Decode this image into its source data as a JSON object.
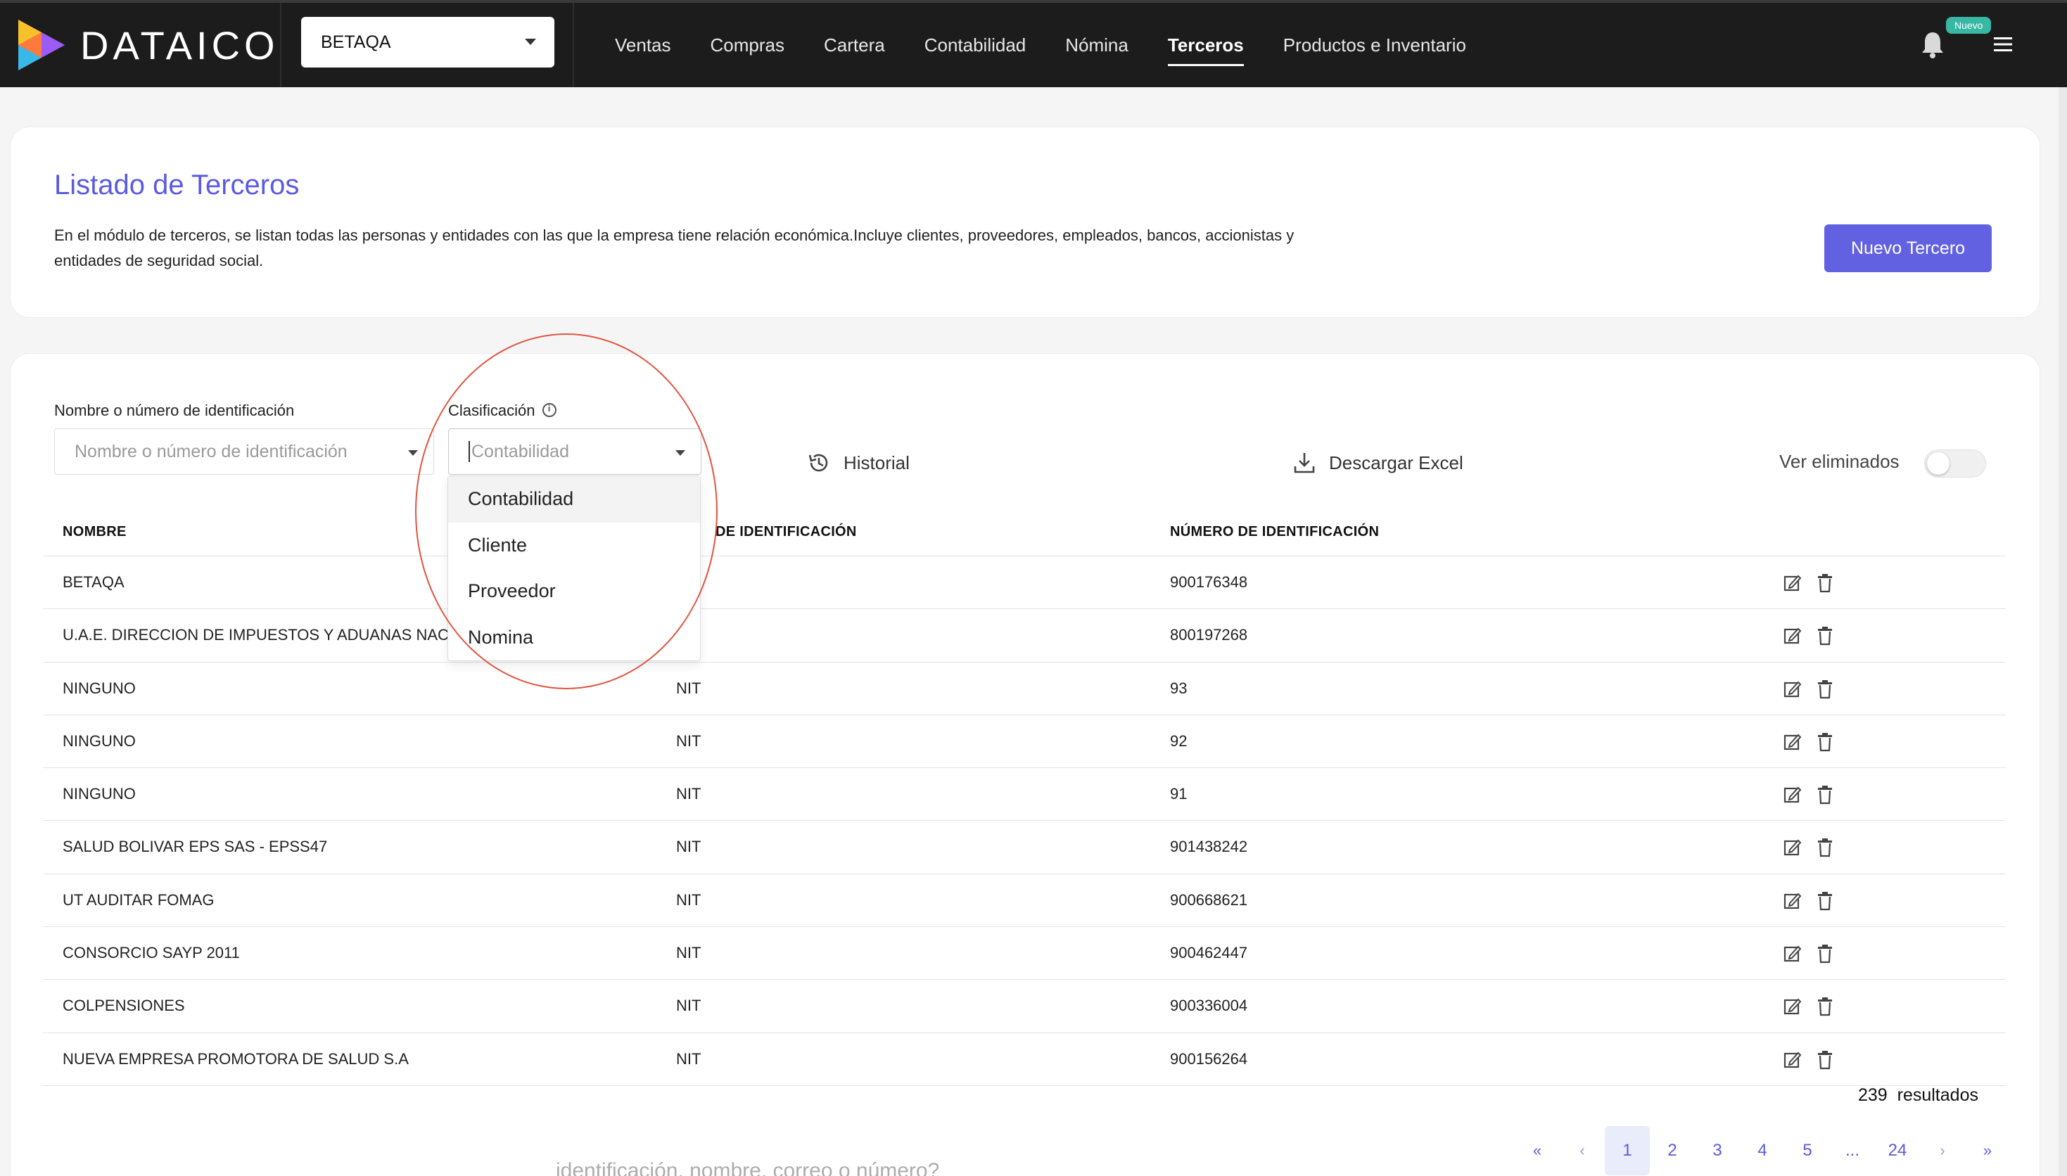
{
  "app": {
    "brand": "DATAICO"
  },
  "header": {
    "company_select": "BETAQA",
    "nav": [
      "Ventas",
      "Compras",
      "Cartera",
      "Contabilidad",
      "Nómina",
      "Terceros",
      "Productos e Inventario"
    ],
    "active_nav": "Terceros",
    "badge": "Nuevo"
  },
  "intro": {
    "title": "Listado de Terceros",
    "description": "En el módulo de terceros, se listan todas las personas y entidades con las que la empresa tiene relación económica.Incluye clientes, proveedores, empleados, bancos, accionistas y entidades de seguridad social.",
    "new_button": "Nuevo Tercero"
  },
  "filters": {
    "name_label": "Nombre o número de identificación",
    "name_placeholder": "Nombre o número de identificación",
    "class_label": "Clasificación",
    "class_placeholder": "Contabilidad",
    "class_options": [
      "Contabilidad",
      "Cliente",
      "Proveedor",
      "Nomina"
    ],
    "history": "Historial",
    "excel": "Descargar Excel",
    "show_deleted": "Ver eliminados"
  },
  "table": {
    "headers": [
      "NOMBRE",
      "DE IDENTIFICACIÓN",
      "NÚMERO DE IDENTIFICACIÓN"
    ],
    "rows": [
      {
        "name": "BETAQA",
        "type": "",
        "number": "900176348"
      },
      {
        "name": "U.A.E. DIRECCION DE IMPUESTOS Y ADUANAS NACIONAL",
        "type": "",
        "number": "800197268"
      },
      {
        "name": "NINGUNO",
        "type": "NIT",
        "number": "93"
      },
      {
        "name": "NINGUNO",
        "type": "NIT",
        "number": "92"
      },
      {
        "name": "NINGUNO",
        "type": "NIT",
        "number": "91"
      },
      {
        "name": "SALUD BOLIVAR EPS SAS - EPSS47",
        "type": "NIT",
        "number": "901438242"
      },
      {
        "name": "UT AUDITAR FOMAG",
        "type": "NIT",
        "number": "900668621"
      },
      {
        "name": "CONSORCIO SAYP 2011",
        "type": "NIT",
        "number": "900462447"
      },
      {
        "name": "COLPENSIONES",
        "type": "NIT",
        "number": "900336004"
      },
      {
        "name": "NUEVA EMPRESA PROMOTORA DE SALUD S.A",
        "type": "NIT",
        "number": "900156264"
      }
    ]
  },
  "results": {
    "count": "239",
    "label": "resultados"
  },
  "pagination": {
    "first": "«",
    "prev": "‹",
    "pages": [
      "1",
      "2",
      "3",
      "4",
      "5",
      "...",
      "24"
    ],
    "next": "›",
    "last": "»",
    "current": "1"
  },
  "footer_ghost": "identificación, nombre, correo o número?",
  "colors": {
    "accent": "#5b5be0",
    "primary_button": "#6261e2",
    "topbar": "#1c1c1c",
    "badge": "#38b7a5",
    "ring": "#e05540"
  }
}
